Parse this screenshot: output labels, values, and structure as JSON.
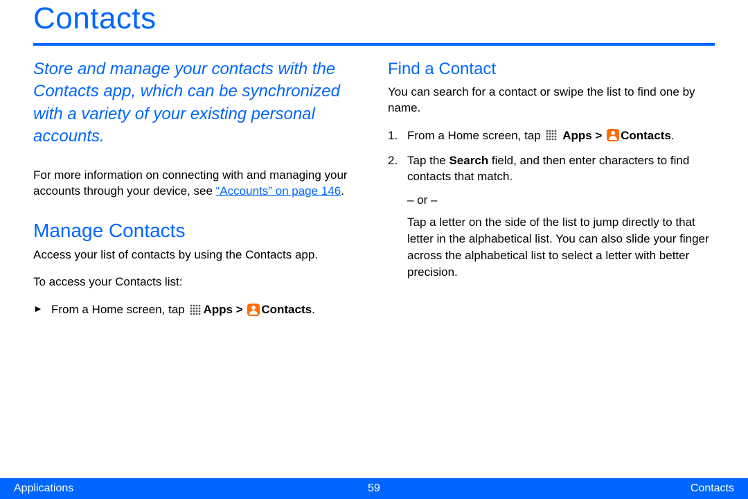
{
  "title": "Contacts",
  "lead": "Store and manage your contacts with the Contacts app, which can be synchronized with a variety of your existing personal accounts.",
  "info_prefix": "For more information on connecting with and managing your accounts through your device, see ",
  "info_link": "“Accounts” on page 146",
  "info_suffix": ".",
  "manage": {
    "heading": "Manage Contacts",
    "p1": "Access your list of contacts by using the Contacts app.",
    "p2": "To access your Contacts list:",
    "step_prefix": "From a Home screen, tap ",
    "apps_label": "Apps > ",
    "contacts_label": "Contacts",
    "step_suffix": "."
  },
  "find": {
    "heading": "Find a Contact",
    "p1": "You can search for a contact or swipe the list to find one by name.",
    "s1_prefix": "From a Home screen, tap ",
    "s1_apps": "Apps > ",
    "s1_contacts": "Contacts",
    "s1_suffix": ".",
    "s2a": "Tap the ",
    "s2b": "Search",
    "s2c": " field, and then enter characters to find contacts that match.",
    "or": "– or –",
    "s2_alt": "Tap a letter on the side of the list to jump directly to that letter in the alphabetical list. You can also slide your finger across the alphabetical list to select a letter with better precision."
  },
  "footer": {
    "left": "Applications",
    "page": "59",
    "right": "Contacts"
  }
}
